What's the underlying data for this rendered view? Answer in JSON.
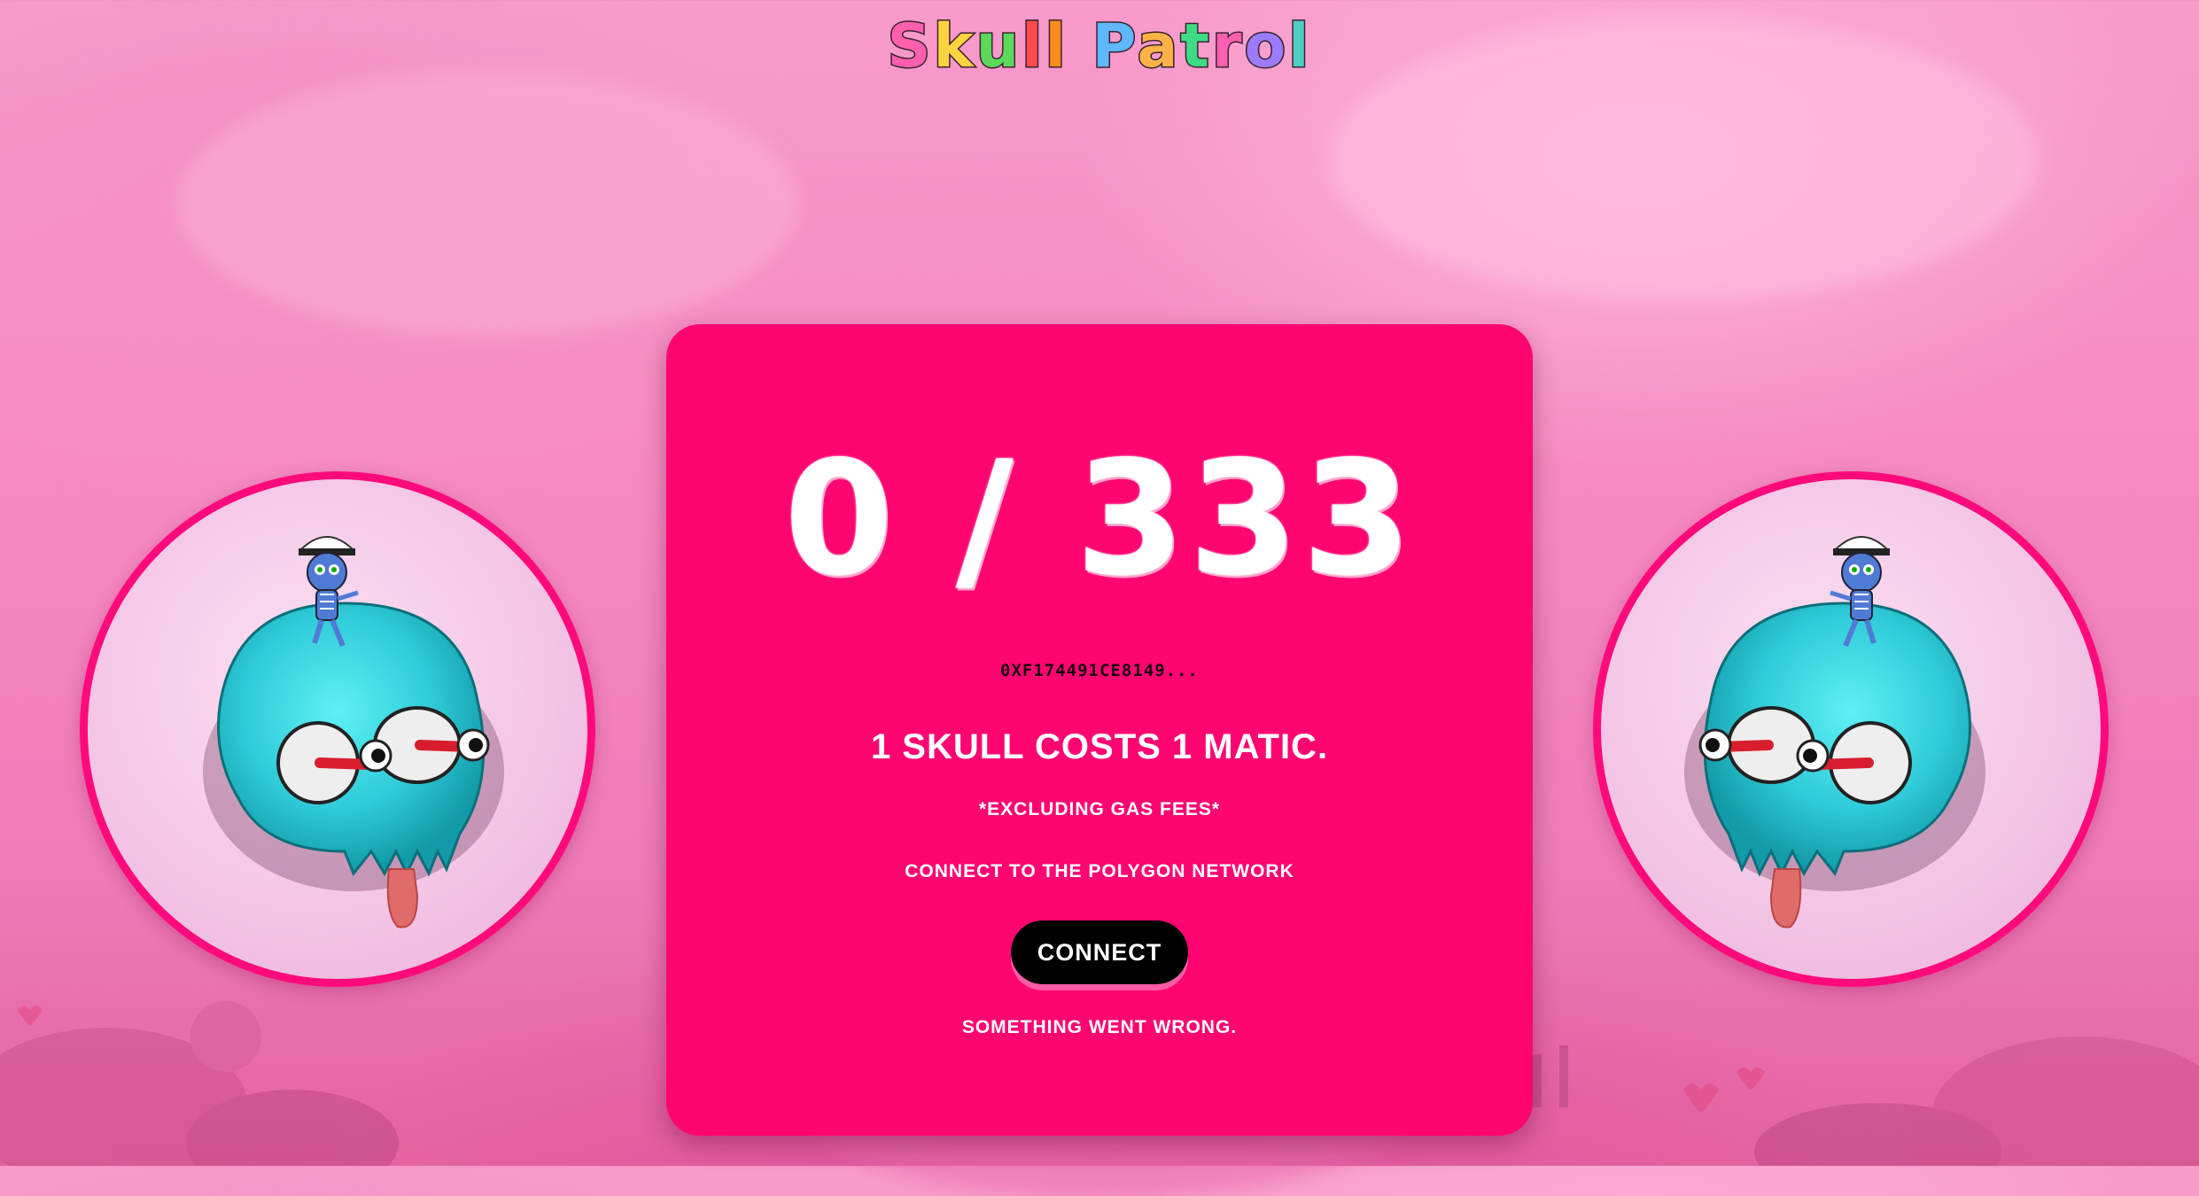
{
  "header": {
    "logo_letters": [
      "S",
      "k",
      "u",
      "l",
      "l",
      " ",
      "P",
      "a",
      "t",
      "r",
      "o",
      "l"
    ],
    "logo_colors": [
      "#ff5fae",
      "#ffd23f",
      "#5bd95b",
      "#ff4a4a",
      "#ff8c1a",
      "#ffffff",
      "#5fb8ff",
      "#ffb347",
      "#3ddc84",
      "#ff5fae",
      "#9b7bff",
      "#4ecdc4"
    ]
  },
  "mint": {
    "counter": "0 / 333",
    "address": "0XF174491CE8149...",
    "cost_text": "1 SKULL COSTS 1 MATIC.",
    "gas_note": "*EXCLUDING GAS FEES*",
    "network_prompt": "CONNECT TO THE POLYGON NETWORK",
    "connect_label": "CONNECT",
    "error_text": "SOMETHING WENT WRONG."
  },
  "colors": {
    "card": "#ff0572",
    "circle_border": "#ff0a7c",
    "skull": "#33d6e0",
    "button": "#000000"
  }
}
